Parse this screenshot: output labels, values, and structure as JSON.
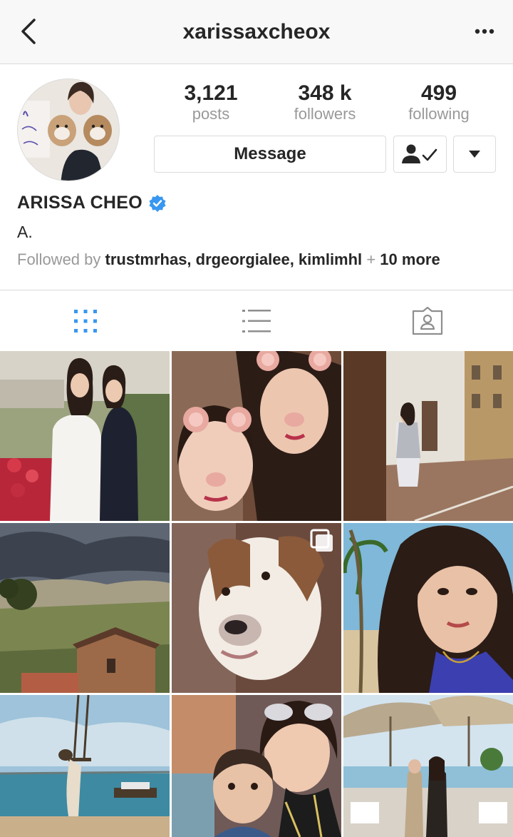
{
  "header": {
    "username": "xarissaxcheox",
    "back_icon": "chevron-left-icon",
    "more_icon": "ellipsis-icon"
  },
  "profile": {
    "stats": [
      {
        "value": "3,121",
        "label": "posts"
      },
      {
        "value": "348 k",
        "label": "followers"
      },
      {
        "value": "499",
        "label": "following"
      }
    ],
    "message_label": "Message",
    "display_name": "ARISSA CHEO",
    "verified": true,
    "bio": "A.",
    "followed_by_prefix": "Followed by",
    "followed_by_users": "trustmrhas, drgeorgialee, kimlimhl",
    "followed_by_plus": "+",
    "followed_by_more": "10 more"
  },
  "tabs": [
    {
      "icon": "grid-icon",
      "active": true
    },
    {
      "icon": "list-icon",
      "active": false
    },
    {
      "icon": "tagged-icon",
      "active": false
    }
  ],
  "colors": {
    "accent_blue": "#3897f0",
    "text_primary": "#262626",
    "text_secondary": "#999999",
    "border": "#dbdbdb"
  },
  "grid_posts": [
    {
      "subject": "two women at garden event"
    },
    {
      "subject": "selfie with bear ear filter"
    },
    {
      "subject": "woman in street with old buildings"
    },
    {
      "subject": "countryside landscape with stone house"
    },
    {
      "subject": "bulldog close-up",
      "multi": true
    },
    {
      "subject": "selfie near palm trees"
    },
    {
      "subject": "figure on swing by the sea"
    },
    {
      "subject": "woman with baby selfie"
    },
    {
      "subject": "beach terrace with umbrellas"
    }
  ]
}
